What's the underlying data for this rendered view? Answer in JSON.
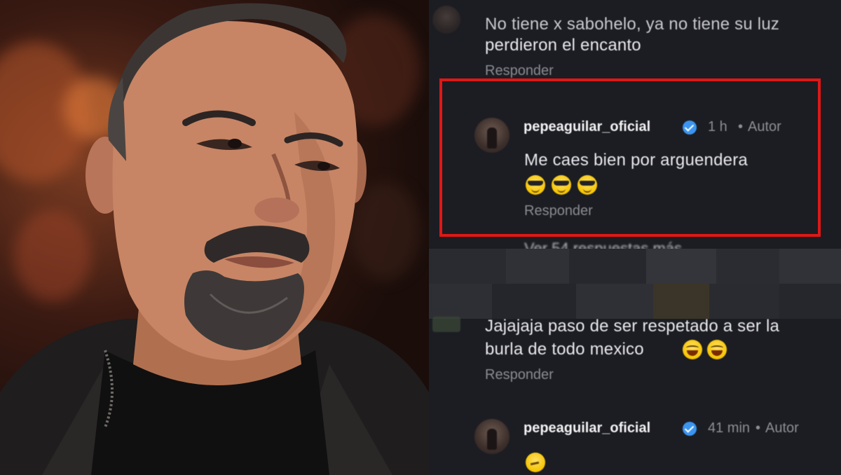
{
  "comments": [
    {
      "id": "c1",
      "text_line1": "No tiene x sabohelo, ya no tiene su luz",
      "text_line2": "perdieron el encanto",
      "reply_label": "Responder"
    },
    {
      "id": "reply1",
      "username": "pepeaguilar_oficial",
      "time": "1 h",
      "role": "Autor",
      "text": "Me caes bien por arguendera",
      "emojis": [
        "smiling-face-with-sunglasses-icon",
        "smiling-face-with-sunglasses-icon",
        "smiling-face-with-sunglasses-icon"
      ],
      "reply_label": "Responder"
    },
    {
      "id": "more",
      "label": "Ver 54 respuestas más"
    },
    {
      "id": "c2",
      "text_line1": "Jajajaja paso de ser respetado a ser la",
      "text_line2": "burla de todo mexico",
      "emojis": [
        "face-with-tears-of-joy-icon",
        "face-with-tears-of-joy-icon"
      ],
      "reply_label": "Responder"
    },
    {
      "id": "reply2",
      "username": "pepeaguilar_oficial",
      "time": "41 min",
      "role": "Autor",
      "emojis": [
        "thinking-face-icon"
      ]
    }
  ],
  "colors": {
    "highlight": "#e01717",
    "verified": "#3b95f0",
    "background": "#1c1d22"
  }
}
